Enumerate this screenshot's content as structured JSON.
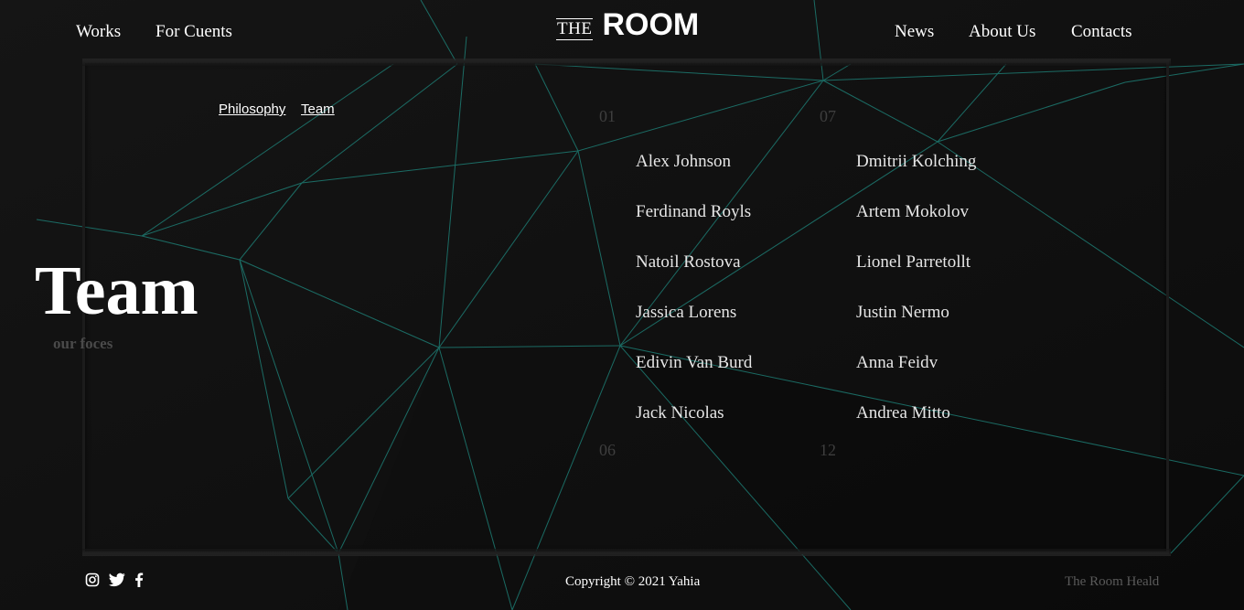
{
  "header": {
    "nav_left": [
      "Works",
      "For Cuents"
    ],
    "logo": {
      "the": "THE",
      "room": "ROOM"
    },
    "nav_right": [
      "News",
      "About Us",
      "Contacts"
    ]
  },
  "section": {
    "subnav": [
      "Philosophy",
      "Team"
    ],
    "title": "Team",
    "subtitle": "our foces"
  },
  "team": {
    "columns": [
      {
        "start": "01",
        "end": "06",
        "members": [
          "Alex Johnson",
          "Ferdinand Royls",
          "Natoil Rostova",
          "Jassica Lorens",
          "Edivin Van Burd",
          "Jack Nicolas"
        ]
      },
      {
        "start": "07",
        "end": "12",
        "members": [
          "Dmitrii Kolching",
          "Artem Mokolov",
          "Lionel Parretollt",
          "Justin Nermo",
          "Anna Feidv",
          "Andrea Mitto"
        ]
      }
    ]
  },
  "footer": {
    "social_icons": [
      "instagram-icon",
      "twitter-icon",
      "facebook-icon"
    ],
    "copyright": "Copyright © 2021 Yahia",
    "right_text": "The Room Heald"
  },
  "colors": {
    "background": "#111111",
    "line_accent": "#1f8a80",
    "text": "#ffffff",
    "muted": "#4a4a4a"
  }
}
